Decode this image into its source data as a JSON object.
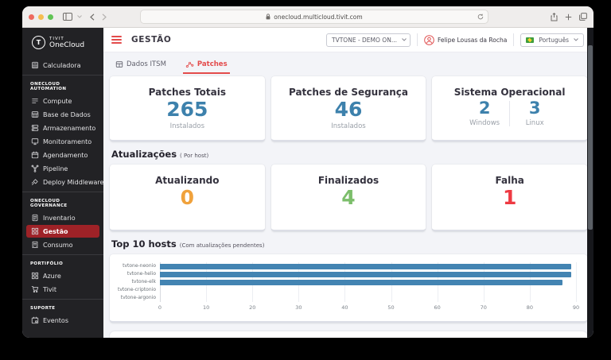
{
  "browser": {
    "url": "onecloud.multicloud.tivit.com"
  },
  "sidebar": {
    "brand": {
      "top": "TIVIT",
      "bottom": "OneCloud"
    },
    "groups": [
      {
        "header": "",
        "items": [
          {
            "label": "Calculadora",
            "icon": "calculator"
          }
        ]
      },
      {
        "header": "ONECLOUD AUTOMATION",
        "items": [
          {
            "label": "Compute",
            "icon": "compute"
          },
          {
            "label": "Base de Dados",
            "icon": "database"
          },
          {
            "label": "Armazenamento",
            "icon": "storage"
          },
          {
            "label": "Monitoramento",
            "icon": "monitor"
          },
          {
            "label": "Agendamento",
            "icon": "calendar"
          },
          {
            "label": "Pipeline",
            "icon": "pipeline"
          },
          {
            "label": "Deploy Middleware",
            "icon": "deploy"
          }
        ]
      },
      {
        "header": "ONECLOUD GOVERNANCE",
        "items": [
          {
            "label": "Inventario",
            "icon": "document"
          },
          {
            "label": "Gestão",
            "icon": "grid",
            "active": true
          },
          {
            "label": "Consumo",
            "icon": "receipt"
          }
        ]
      },
      {
        "header": "PORTIFÓLIO",
        "items": [
          {
            "label": "Azure",
            "icon": "grid"
          },
          {
            "label": "Tivit",
            "icon": "cart"
          }
        ]
      },
      {
        "header": "SUPORTE",
        "items": [
          {
            "label": "Eventos",
            "icon": "calendar-event"
          }
        ]
      }
    ]
  },
  "header": {
    "title": "GESTÃO",
    "org_selector": "TVTONE - DEMO ON...",
    "user_name": "Felipe Lousas da Rocha",
    "language": "Português"
  },
  "tabs": {
    "itsm": "Dados ITSM",
    "patches": "Patches"
  },
  "cards": {
    "row1": [
      {
        "title": "Patches Totais",
        "value": "265",
        "label": "Instalados"
      },
      {
        "title": "Patches de Segurança",
        "value": "46",
        "label": "Instalados"
      },
      {
        "title": "Sistema Operacional",
        "values": [
          {
            "value": "2",
            "label": "Windows"
          },
          {
            "value": "3",
            "label": "Linux"
          }
        ]
      }
    ],
    "row2": [
      {
        "title": "Atualizando",
        "value": "0"
      },
      {
        "title": "Finalizados",
        "value": "4"
      },
      {
        "title": "Falha",
        "value": "1"
      }
    ]
  },
  "sections": {
    "updates": {
      "title": "Atualizações",
      "subtitle": "( Por host)"
    },
    "top_hosts": {
      "title": "Top 10 hosts",
      "subtitle": "(Com atualizações pendentes)"
    }
  },
  "colors": {
    "blue": "#3d81ac",
    "orange": "#f0a23c",
    "green": "#7cbe6b",
    "red": "#ee3a43",
    "accent_red": "#e34b4b",
    "sidebar_active": "#9e2227",
    "bar_blue": "#4384b2"
  },
  "chart_data": {
    "type": "bar",
    "orientation": "horizontal",
    "title": "Top 10 hosts",
    "subtitle": "(Com atualizações pendentes)",
    "categories": [
      "tvtone-neonio",
      "tvtone-helio",
      "tvtone-elk",
      "tvtone-criptonio",
      "tvtone-argonio"
    ],
    "values": [
      89,
      89,
      87,
      0,
      0
    ],
    "xlim": [
      0,
      90
    ],
    "xticks": [
      0,
      10,
      20,
      30,
      40,
      50,
      60,
      70,
      80,
      90
    ],
    "grid": true,
    "legend": false
  }
}
